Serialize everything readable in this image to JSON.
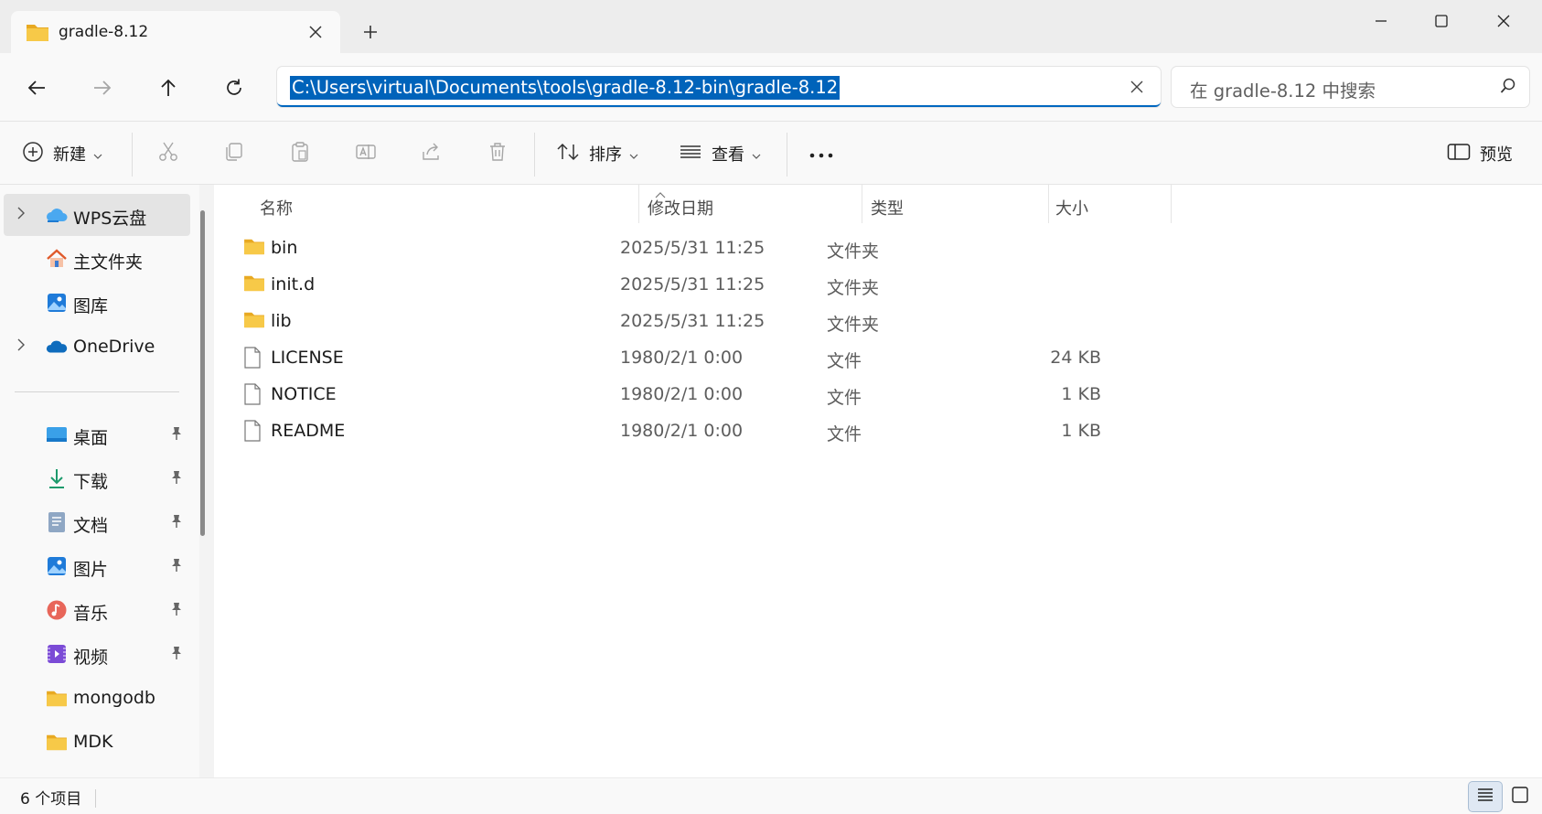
{
  "window": {
    "tab_title": "gradle-8.12",
    "new_tab": "+"
  },
  "address": {
    "path": "C:\\Users\\virtual\\Documents\\tools\\gradle-8.12-bin\\gradle-8.12"
  },
  "search": {
    "placeholder": "在 gradle-8.12 中搜索"
  },
  "toolbar": {
    "new_label": "新建",
    "sort_label": "排序",
    "view_label": "查看",
    "more_label": "···",
    "preview_label": "预览"
  },
  "sidebar": {
    "items": [
      {
        "label": "WPS云盘",
        "icon": "cloud-icon"
      },
      {
        "label": "主文件夹",
        "icon": "home-icon"
      },
      {
        "label": "图库",
        "icon": "gallery-icon"
      },
      {
        "label": "OneDrive",
        "icon": "onedrive-icon"
      },
      {
        "label": "桌面",
        "icon": "desktop-icon"
      },
      {
        "label": "下载",
        "icon": "download-icon"
      },
      {
        "label": "文档",
        "icon": "document-icon"
      },
      {
        "label": "图片",
        "icon": "pictures-icon"
      },
      {
        "label": "音乐",
        "icon": "music-icon"
      },
      {
        "label": "视频",
        "icon": "video-icon"
      },
      {
        "label": "mongodb",
        "icon": "folder-icon"
      },
      {
        "label": "MDK",
        "icon": "folder-icon"
      }
    ]
  },
  "columns": {
    "name": "名称",
    "modified": "修改日期",
    "type": "类型",
    "size": "大小"
  },
  "files": [
    {
      "name": "bin",
      "modified": "2025/5/31 11:25",
      "type": "文件夹",
      "size": "",
      "icon": "folder-icon"
    },
    {
      "name": "init.d",
      "modified": "2025/5/31 11:25",
      "type": "文件夹",
      "size": "",
      "icon": "folder-icon"
    },
    {
      "name": "lib",
      "modified": "2025/5/31 11:25",
      "type": "文件夹",
      "size": "",
      "icon": "folder-icon"
    },
    {
      "name": "LICENSE",
      "modified": "1980/2/1 0:00",
      "type": "文件",
      "size": "24 KB",
      "icon": "file-icon"
    },
    {
      "name": "NOTICE",
      "modified": "1980/2/1 0:00",
      "type": "文件",
      "size": "1 KB",
      "icon": "file-icon"
    },
    {
      "name": "README",
      "modified": "1980/2/1 0:00",
      "type": "文件",
      "size": "1 KB",
      "icon": "file-icon"
    }
  ],
  "status": {
    "item_count": "6 个项目"
  },
  "colors": {
    "accent": "#0067c0",
    "selection": "#0063ba",
    "folder": "#f7c948"
  }
}
